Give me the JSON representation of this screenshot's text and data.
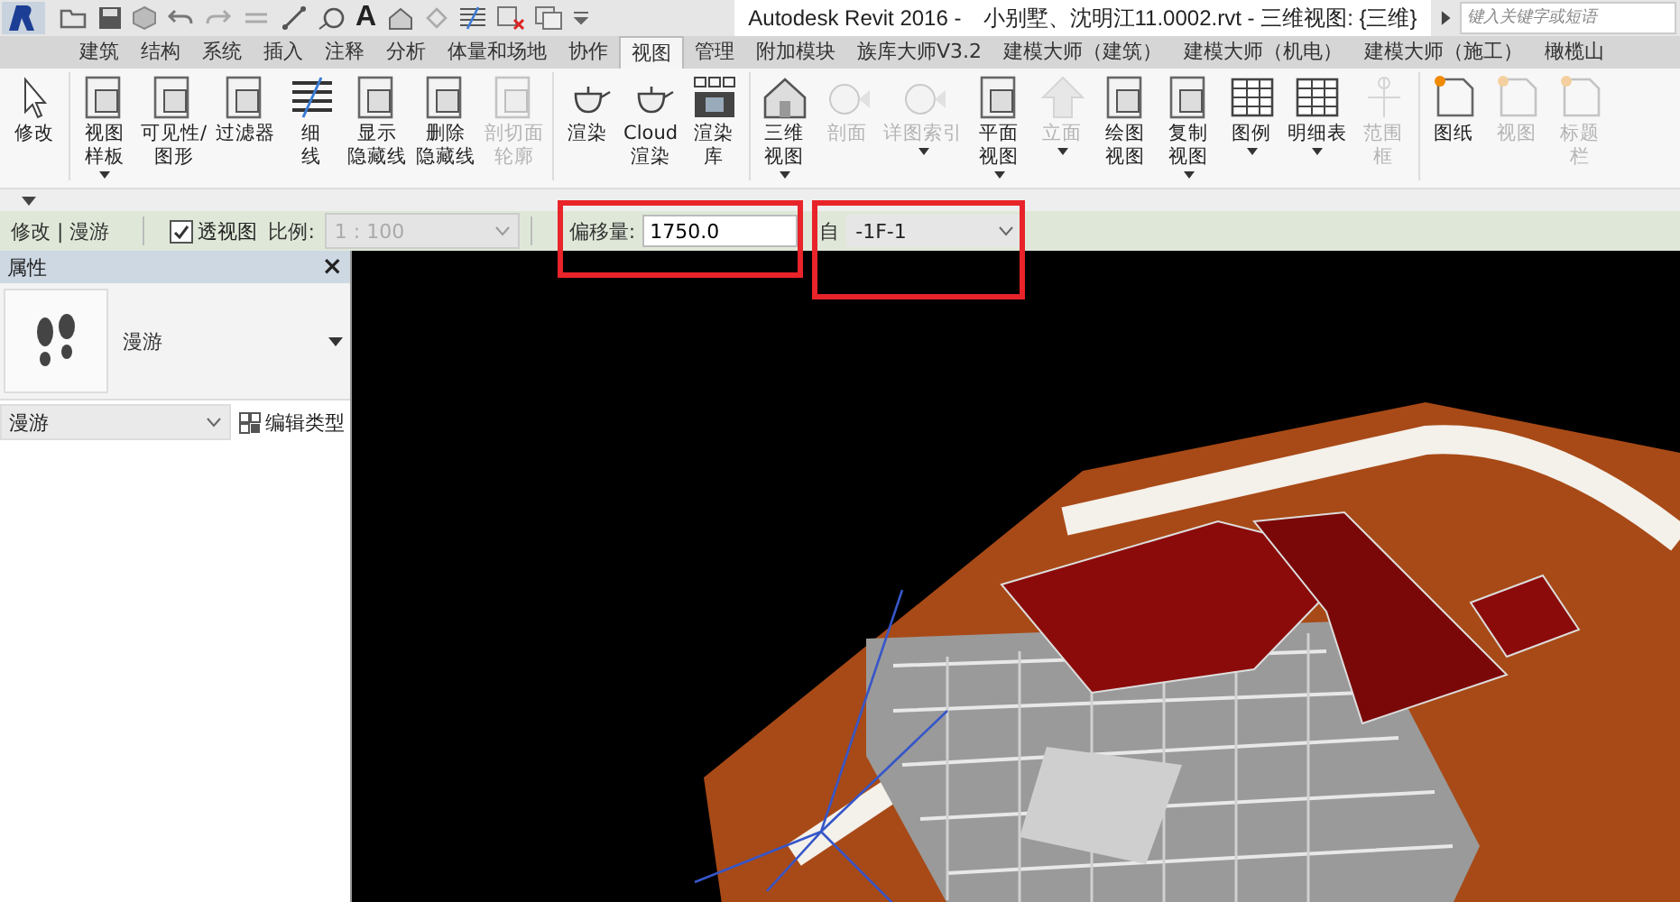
{
  "title_bar": {
    "text_tool": "A",
    "app_title": "Autodesk Revit 2016 -",
    "file_title": "小别墅、沈明江11.0002.rvt - 三维视图: {三维}",
    "search": {
      "placeholder": "键入关键字或短语"
    }
  },
  "tabs": [
    {
      "label": "建筑",
      "selected": false
    },
    {
      "label": "结构",
      "selected": false
    },
    {
      "label": "系统",
      "selected": false
    },
    {
      "label": "插入",
      "selected": false
    },
    {
      "label": "注释",
      "selected": false
    },
    {
      "label": "分析",
      "selected": false
    },
    {
      "label": "体量和场地",
      "selected": false
    },
    {
      "label": "协作",
      "selected": false
    },
    {
      "label": "视图",
      "selected": true
    },
    {
      "label": "管理",
      "selected": false
    },
    {
      "label": "附加模块",
      "selected": false
    },
    {
      "label": "族库大师V3.2",
      "selected": false
    },
    {
      "label": "建模大师（建筑）",
      "selected": false
    },
    {
      "label": "建模大师（机电）",
      "selected": false
    },
    {
      "label": "建模大师（施工）",
      "selected": false
    },
    {
      "label": "橄榄山",
      "selected": false
    }
  ],
  "ribbon": {
    "panels": [
      {
        "buttons": [
          {
            "lines": [
              "修改"
            ],
            "disabled": false,
            "dropdown": false
          }
        ]
      },
      {
        "buttons": [
          {
            "lines": [
              "视图",
              "样板"
            ],
            "disabled": false,
            "dropdown": true
          },
          {
            "lines": [
              "可见性/",
              "图形"
            ],
            "disabled": false,
            "dropdown": false
          },
          {
            "lines": [
              "过滤器"
            ],
            "disabled": false,
            "dropdown": false
          },
          {
            "lines": [
              "细",
              "线"
            ],
            "disabled": false,
            "dropdown": false
          },
          {
            "lines": [
              "显示",
              "隐藏线"
            ],
            "disabled": false,
            "dropdown": false
          },
          {
            "lines": [
              "删除",
              "隐藏线"
            ],
            "disabled": false,
            "dropdown": false
          },
          {
            "lines": [
              "剖切面",
              "轮廓"
            ],
            "disabled": true,
            "dropdown": false
          }
        ]
      },
      {
        "buttons": [
          {
            "lines": [
              "渲染"
            ],
            "disabled": false,
            "dropdown": false
          },
          {
            "lines": [
              "Cloud",
              "渲染"
            ],
            "disabled": false,
            "dropdown": false
          },
          {
            "lines": [
              "渲染",
              "库"
            ],
            "disabled": false,
            "dropdown": false
          }
        ]
      },
      {
        "buttons": [
          {
            "lines": [
              "三维",
              "视图"
            ],
            "disabled": false,
            "dropdown": true
          },
          {
            "lines": [
              "剖面"
            ],
            "disabled": true,
            "dropdown": false
          },
          {
            "lines": [
              "详图索引"
            ],
            "disabled": true,
            "dropdown": true
          },
          {
            "lines": [
              "平面",
              "视图"
            ],
            "disabled": false,
            "dropdown": true
          },
          {
            "lines": [
              "立面"
            ],
            "disabled": true,
            "dropdown": true
          },
          {
            "lines": [
              "绘图",
              "视图"
            ],
            "disabled": false,
            "dropdown": false
          },
          {
            "lines": [
              "复制",
              "视图"
            ],
            "disabled": false,
            "dropdown": true
          },
          {
            "lines": [
              "图例"
            ],
            "disabled": false,
            "dropdown": true
          },
          {
            "lines": [
              "明细表"
            ],
            "disabled": false,
            "dropdown": true
          },
          {
            "lines": [
              "范围",
              "框"
            ],
            "disabled": true,
            "dropdown": false
          }
        ]
      },
      {
        "buttons": [
          {
            "lines": [
              "图纸"
            ],
            "disabled": false,
            "dropdown": false
          },
          {
            "lines": [
              "视图"
            ],
            "disabled": true,
            "dropdown": false
          },
          {
            "lines": [
              "标题",
              "栏"
            ],
            "disabled": true,
            "dropdown": false
          }
        ]
      }
    ]
  },
  "options_bar": {
    "mode": "修改 | 漫游",
    "perspective": {
      "label": "透视图",
      "checked": true
    },
    "scale": {
      "label": "比例:",
      "value": "1 : 100",
      "disabled": true
    },
    "offset": {
      "label": "偏移量:",
      "value": "1750.0"
    },
    "level": {
      "label": "自",
      "value": "-1F-1"
    }
  },
  "properties": {
    "title": "属性",
    "close": "×",
    "type_name": "漫游",
    "selector": "漫游",
    "edit_type": "编辑类型"
  }
}
